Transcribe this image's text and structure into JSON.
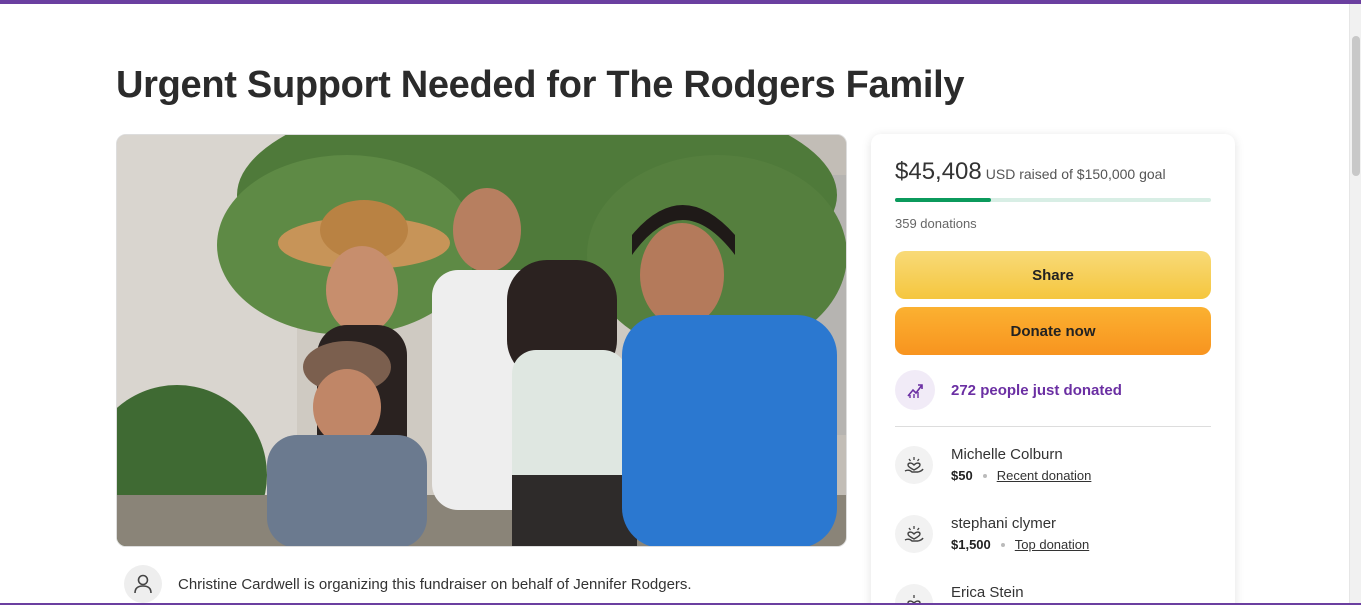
{
  "page": {
    "title": "Urgent Support Needed for The Rodgers Family"
  },
  "organizer": {
    "text": "Christine Cardwell is organizing this fundraiser on behalf of Jennifer Rodgers."
  },
  "fundraiser": {
    "amount_raised": "$45,408",
    "raised_of_goal": "USD raised of $150,000 goal",
    "progress_fraction": 0.303,
    "donation_count": "359 donations",
    "share_label": "Share",
    "donate_label": "Donate now",
    "momentum_text": "272 people just donated"
  },
  "donations": [
    {
      "name": "Michelle Colburn",
      "amount": "$50",
      "tag": "Recent donation"
    },
    {
      "name": "stephani clymer",
      "amount": "$1,500",
      "tag": "Top donation"
    },
    {
      "name": "Erica Stein"
    }
  ],
  "colors": {
    "brand_purple": "#6b3fa0",
    "progress_green": "#0b9a5c",
    "share_yellow": "#f5c63e",
    "donate_orange": "#f8941f"
  },
  "icons": {
    "organizer": "user-icon",
    "momentum": "trending-up-icon",
    "donor": "heart-hand-icon"
  }
}
